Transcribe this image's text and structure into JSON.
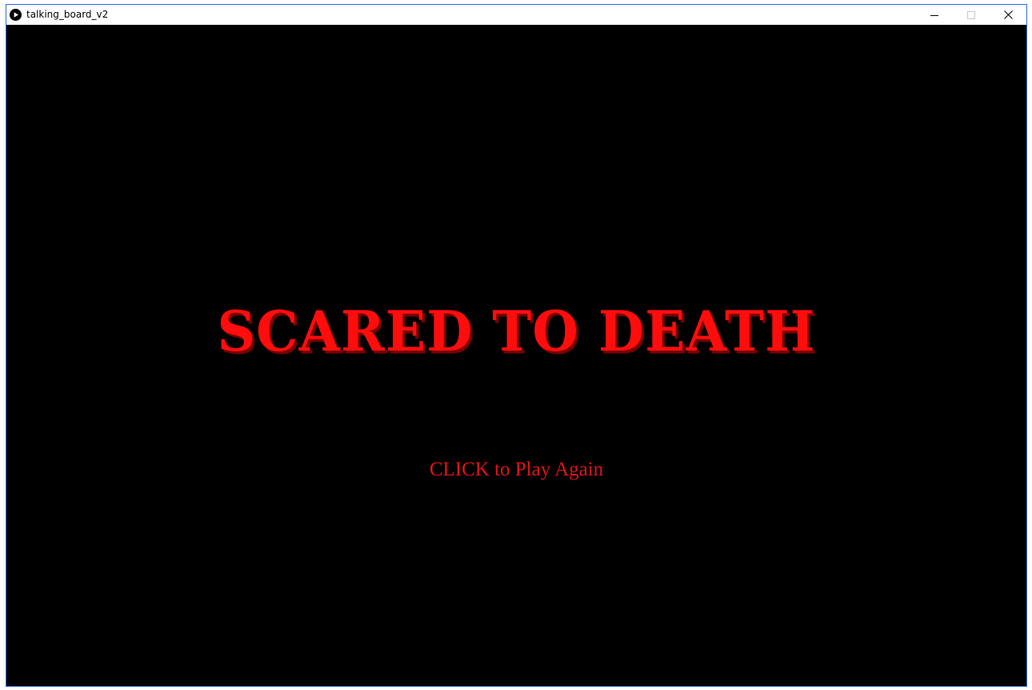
{
  "window": {
    "title": "talking_board_v2",
    "border_color": "#2f6fd6"
  },
  "icons": {
    "app": "play-circle-icon",
    "minimize": "minimize-icon",
    "maximize": "maximize-icon",
    "close": "close-icon"
  },
  "game": {
    "title": "SCARED TO DEATH",
    "prompt": "CLICK to Play Again",
    "background_color": "#000000",
    "text_color": "#ff0d0d"
  }
}
